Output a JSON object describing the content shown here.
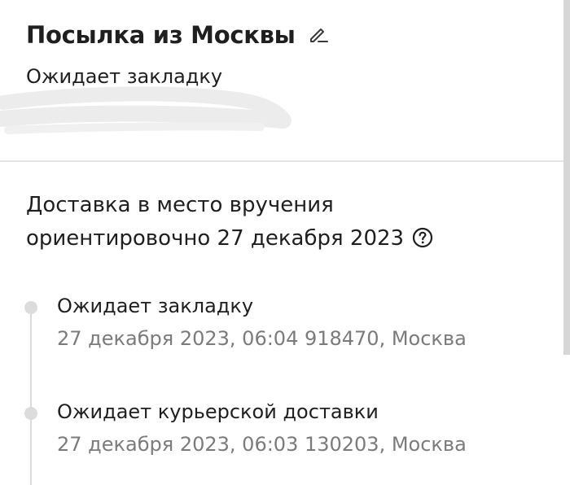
{
  "parcel": {
    "title": "Посылка из Москвы",
    "status": "Ожидает закладку"
  },
  "icons": {
    "edit": "pencil-icon",
    "help": "question-circle-icon"
  },
  "delivery": {
    "line1": "Доставка в место вручения",
    "line2": "ориентировочно 27 декабря 2023"
  },
  "timeline": [
    {
      "title": "Ожидает закладку",
      "meta": "27 декабря 2023, 06:04 918470, Москва"
    },
    {
      "title": "Ожидает курьерской доставки",
      "meta": "27 декабря 2023, 06:03 130203, Москва"
    }
  ],
  "colors": {
    "text": "#1f1f1f",
    "secondary_text": "#7b7b7b",
    "timeline": "#dcdcdc",
    "redaction": "#ececec"
  }
}
